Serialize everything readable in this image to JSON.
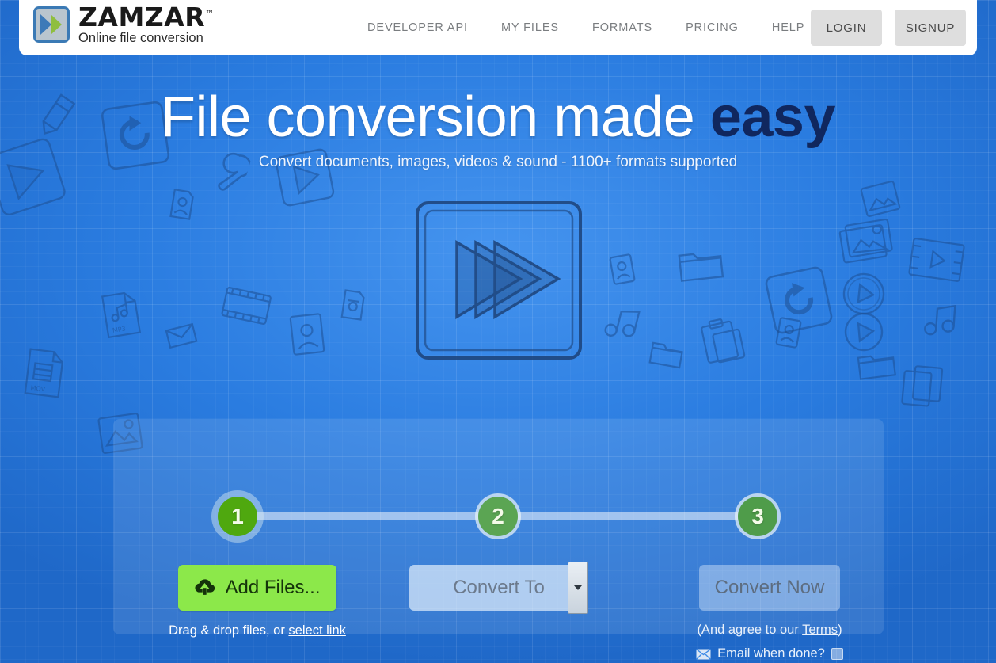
{
  "header": {
    "logo": {
      "icon": "zamzar-double-arrow-logo-icon",
      "title": "ZAMZAR",
      "trademark": "™",
      "subtitle": "Online file conversion",
      "colors": {
        "border": "#3b7ab5",
        "fill": "#b9c5ce",
        "arrow_blue": "#3d7ab8",
        "arrow_green": "#8fbe3f"
      }
    },
    "nav": [
      {
        "label": "DEVELOPER API",
        "name": "nav-developer-api"
      },
      {
        "label": "MY FILES",
        "name": "nav-my-files"
      },
      {
        "label": "FORMATS",
        "name": "nav-formats"
      },
      {
        "label": "PRICING",
        "name": "nav-pricing"
      },
      {
        "label": "HELP",
        "name": "nav-help"
      }
    ],
    "login_label": "LOGIN",
    "signup_label": "SIGNUP"
  },
  "hero": {
    "title_plain": "File conversion made ",
    "title_accent": "easy",
    "subtitle": "Convert documents, images, videos & sound - 1100+ formats supported",
    "illustration_icon": "fast-forward-sketch-icon",
    "background_doodles": [
      "pencil-icon",
      "refresh-icon",
      "wrench-icon",
      "triangle-play-icon",
      "mp3-file-icon",
      "envelope-icon",
      "image-file-icon",
      "mov-file-icon",
      "film-strip-icon",
      "contact-card-icon",
      "photo-stack-icon",
      "video-frame-icon",
      "play-circle-icon",
      "music-note-icon",
      "folder-icon",
      "clipboard-icon",
      "copy-icon",
      "camera-file-icon"
    ]
  },
  "convert_panel": {
    "steps": [
      {
        "number": "1",
        "state": "active"
      },
      {
        "number": "2",
        "state": "inactive"
      },
      {
        "number": "3",
        "state": "inactive"
      }
    ],
    "step1": {
      "add_files_label": "Add Files...",
      "add_files_icon": "cloud-upload-icon",
      "hint_prefix": "Drag & drop files, or ",
      "hint_link": "select link"
    },
    "step2": {
      "convert_to_value": "Convert To",
      "dropdown_arrow_icon": "chevron-down-icon"
    },
    "step3": {
      "convert_now_label": "Convert Now",
      "terms_prefix": "(And agree to our ",
      "terms_link": "Terms",
      "terms_suffix": ")",
      "email_icon": "envelope-icon",
      "email_label": "Email when done?",
      "email_checked": false
    }
  },
  "colors": {
    "page_background": "#2a7ce0",
    "header_background": "#ffffff",
    "accent_green": "#8ce84a",
    "step_active_green": "#4fa80f",
    "step_inactive_green": "#5ba553",
    "title_accent_navy": "#10275e",
    "auth_button_gray": "#dedede"
  }
}
